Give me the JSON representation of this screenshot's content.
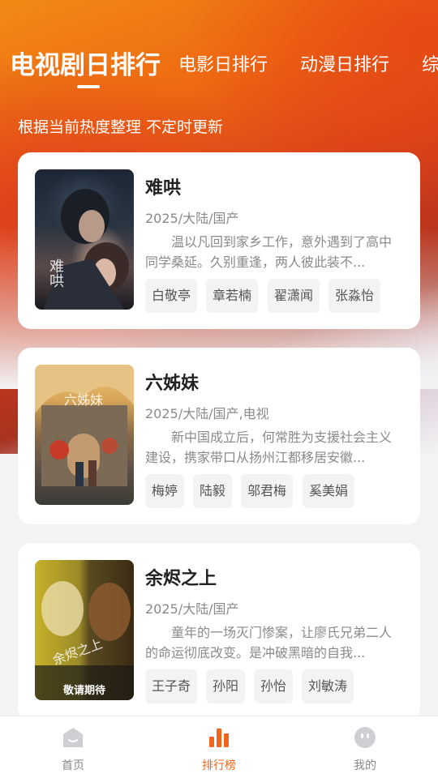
{
  "tabs": [
    {
      "label": "电视剧日排行",
      "active": true
    },
    {
      "label": "电影日排行",
      "active": false
    },
    {
      "label": "动漫日排行",
      "active": false
    },
    {
      "label": "综",
      "active": false
    }
  ],
  "subtitle": "根据当前热度整理 不定时更新",
  "cards": [
    {
      "title": "难哄",
      "meta": "2025/大陆/国产",
      "desc": "温以凡回到家乡工作，意外遇到了高中同学桑延。久别重逢，两人彼此装不...",
      "tags": [
        "白敬亭",
        "章若楠",
        "翟潇闻",
        "张淼怡"
      ],
      "poster_title": "难哄"
    },
    {
      "title": "六姊妹",
      "meta": "2025/大陆/国产,电视",
      "desc": "新中国成立后，何常胜为支援社会主义建设，携家带口从扬州江都移居安徽...",
      "tags": [
        "梅婷",
        "陆毅",
        "邬君梅",
        "奚美娟"
      ],
      "poster_title": "六姊妹"
    },
    {
      "title": "余烬之上",
      "meta": "2025/大陆/国产",
      "desc": "童年的一场灭门惨案，让廖氏兄弟二人的命运彻底改变。是冲破黑暗的自我...",
      "tags": [
        "王子奇",
        "孙阳",
        "孙怡",
        "刘敏涛"
      ],
      "poster_title": "余烬之上",
      "poster_caption": "敬请期待"
    }
  ],
  "nav": [
    {
      "label": "首页",
      "icon": "home-icon",
      "active": false
    },
    {
      "label": "排行榜",
      "icon": "ranking-icon",
      "active": true
    },
    {
      "label": "我的",
      "icon": "profile-icon",
      "active": false
    }
  ],
  "colors": {
    "accent": "#f0661c",
    "header_orange": "#ef6a12",
    "header_red": "#c2361c"
  }
}
